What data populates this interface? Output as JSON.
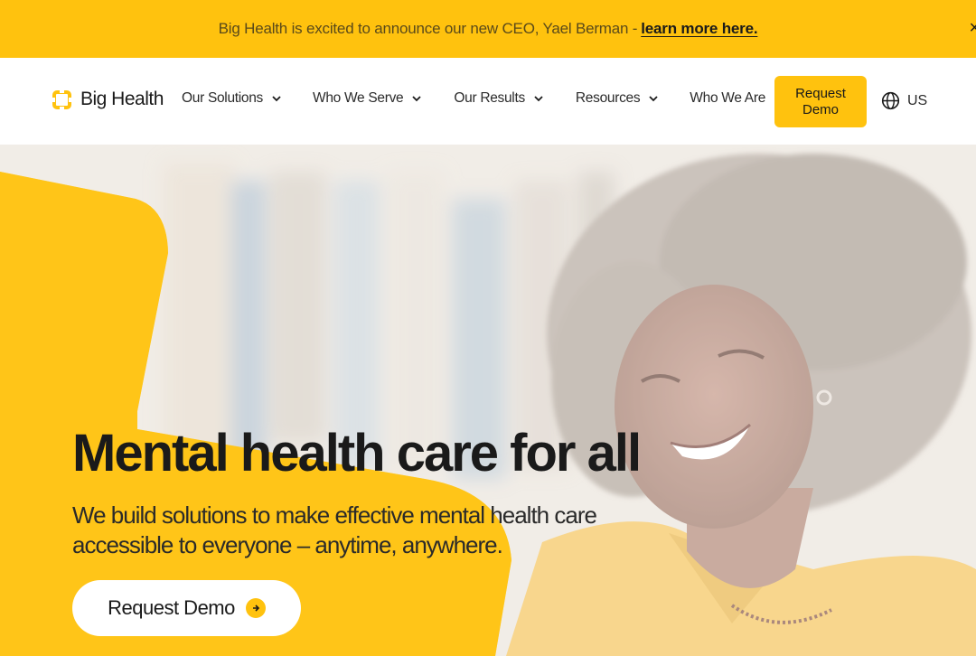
{
  "announcement": {
    "text": "Big Health is excited to announce our new CEO, Yael Berman -",
    "link_label": "learn more here.",
    "close_glyph": "×"
  },
  "header": {
    "logo_text": "Big Health",
    "nav": [
      {
        "label": "Our Solutions"
      },
      {
        "label": "Who We Serve"
      },
      {
        "label": "Our Results"
      },
      {
        "label": "Resources"
      },
      {
        "label": "Who We Are"
      }
    ],
    "request_demo": "Request Demo",
    "language": "US",
    "language_icon": "globe-icon"
  },
  "hero": {
    "title": "Mental health care for all",
    "subtitle": "We build solutions to make effective mental health care accessible to everyone – anytime, anywhere.",
    "cta_label": "Request Demo",
    "cta_icon": "arrow-right-icon"
  },
  "colors": {
    "brand_yellow": "#FFC20E",
    "text_dark": "#1a1a1a"
  }
}
